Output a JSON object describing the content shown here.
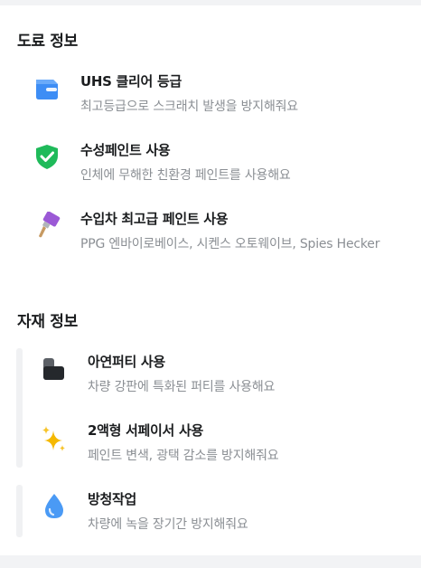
{
  "paint_section": {
    "title": "도료 정보",
    "items": [
      {
        "icon": "paint-bucket-icon",
        "title": "UHS 클리어 등급",
        "desc": "최고등급으로 스크래치 발생을 방지해줘요"
      },
      {
        "icon": "shield-check-icon",
        "title": "수성페인트 사용",
        "desc": "인체에 무해한 친환경 페인트를 사용해요"
      },
      {
        "icon": "paint-brush-icon",
        "title": "수입차 최고급 페인트 사용",
        "desc": "PPG 엔바이로베이스, 시켄스 오토웨이브, Spies Hecker"
      }
    ]
  },
  "material_section": {
    "title": "자재 정보",
    "items": [
      {
        "icon": "putty-block-icon",
        "title": "아연퍼티 사용",
        "desc": "차량 강판에 특화된 퍼티를 사용해요"
      },
      {
        "icon": "sparkles-icon",
        "title": "2액형 서페이서 사용",
        "desc": "페인트 변색, 광택 감소를 방지해줘요"
      },
      {
        "icon": "water-drop-icon",
        "title": "방청작업",
        "desc": "차량에 녹을 장기간 방지해줘요"
      }
    ]
  }
}
